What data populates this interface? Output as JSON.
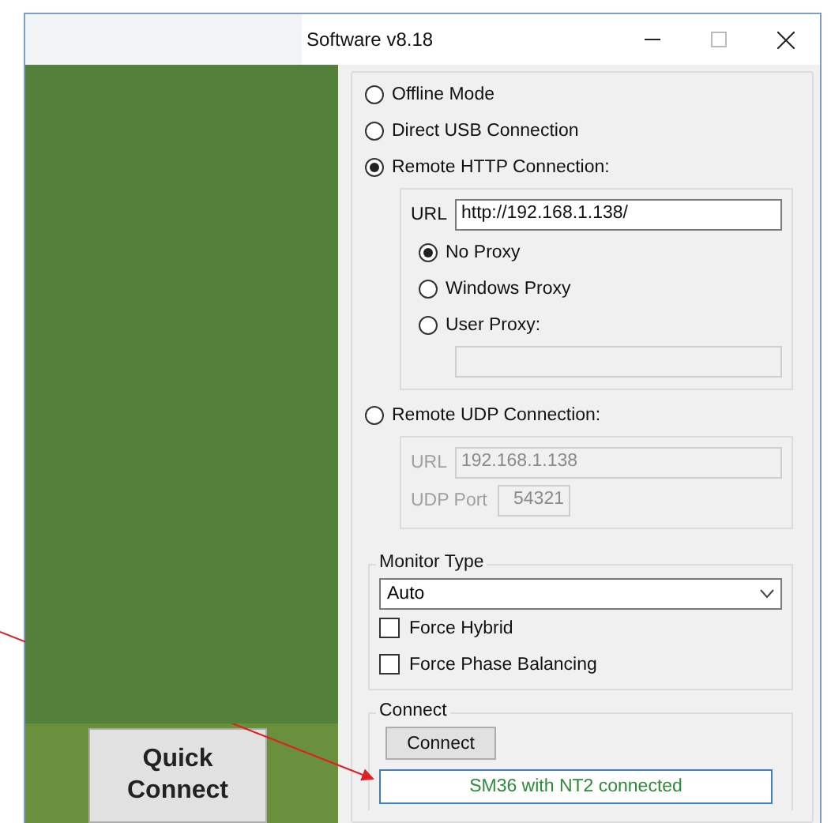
{
  "window": {
    "title": "Software v8.18"
  },
  "quick_connect": {
    "label": "Quick Connect"
  },
  "modes": [
    {
      "label": "Offline Mode",
      "selected": false
    },
    {
      "label": "Direct USB Connection",
      "selected": false
    },
    {
      "label": "Remote HTTP Connection:",
      "selected": true,
      "http": {
        "url_label": "URL",
        "url": "http://192.168.1.138/",
        "proxies": [
          {
            "label": "No Proxy",
            "selected": true
          },
          {
            "label": "Windows Proxy",
            "selected": false
          },
          {
            "label": "User Proxy:",
            "selected": false
          }
        ],
        "user_proxy_field": {
          "disabled": true
        }
      }
    },
    {
      "label": "Remote UDP Connection:",
      "selected": false,
      "udp": {
        "disabled": true,
        "url_label": "URL",
        "url": "192.168.1.138",
        "port_label": "UDP Port",
        "port": "54321"
      }
    }
  ],
  "monitor": {
    "title": "Monitor Type",
    "value": "Auto",
    "options": [
      {
        "label": "Force Hybrid",
        "checked": false
      },
      {
        "label": "Force Phase Balancing",
        "checked": false
      }
    ]
  },
  "connect": {
    "title": "Connect",
    "button": "Connect",
    "status": "SM36 with NT2 connected"
  }
}
